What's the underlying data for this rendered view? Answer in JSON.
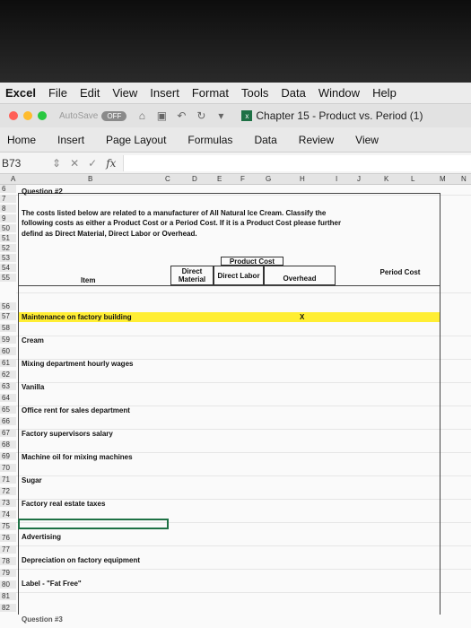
{
  "menubar": {
    "app": "Excel",
    "items": [
      "File",
      "Edit",
      "View",
      "Insert",
      "Format",
      "Tools",
      "Data",
      "Window",
      "Help"
    ]
  },
  "titlebar": {
    "autosave": "AutoSave",
    "toggle": "OFF",
    "document": "Chapter 15 - Product vs. Period (1)"
  },
  "ribbon": {
    "tabs": [
      "Home",
      "Insert",
      "Page Layout",
      "Formulas",
      "Data",
      "Review",
      "View"
    ]
  },
  "formulabar": {
    "cell": "B73",
    "fx": "fx"
  },
  "columns": [
    "A",
    "B",
    "C",
    "D",
    "E",
    "F",
    "G",
    "H",
    "I",
    "J",
    "K",
    "L",
    "M",
    "N"
  ],
  "rows": [
    "6",
    "7",
    "8",
    "9",
    "50",
    "51",
    "52",
    "53",
    "54",
    "55",
    "56",
    "57",
    "58",
    "59",
    "60",
    "61",
    "62",
    "63",
    "64",
    "65",
    "66",
    "67",
    "68",
    "69",
    "70",
    "71",
    "72",
    "73",
    "74",
    "75",
    "76",
    "77",
    "78",
    "79",
    "80",
    "81",
    "82"
  ],
  "sheet": {
    "question": "Question #2",
    "intro1": "The costs listed below are related to a manufacturer of All Natural Ice Cream. Classify the",
    "intro2": "following costs as either a Product Cost or a Period Cost. If it is a Product Cost please further",
    "intro3": "defind as Direct Material, Direct Labor or Overhead.",
    "product_cost": "Product Cost",
    "direct_material": "Direct Material",
    "direct_labor": "Direct Labor",
    "overhead": "Overhead",
    "period_cost": "Period Cost",
    "item": "Item",
    "mark": "X",
    "items": [
      "Maintenance on factory building",
      "Cream",
      "Mixing department hourly wages",
      "Vanilla",
      "Office rent for sales department",
      "Factory supervisors salary",
      "Machine oil for mixing machines",
      "Sugar",
      "Factory real estate taxes",
      "Advertising",
      "Depreciation on factory equipment",
      "Label - \"Fat Free\""
    ],
    "next": "Question #3"
  },
  "colors": {
    "highlight": "#ffee33",
    "selection": "#1e7145"
  }
}
